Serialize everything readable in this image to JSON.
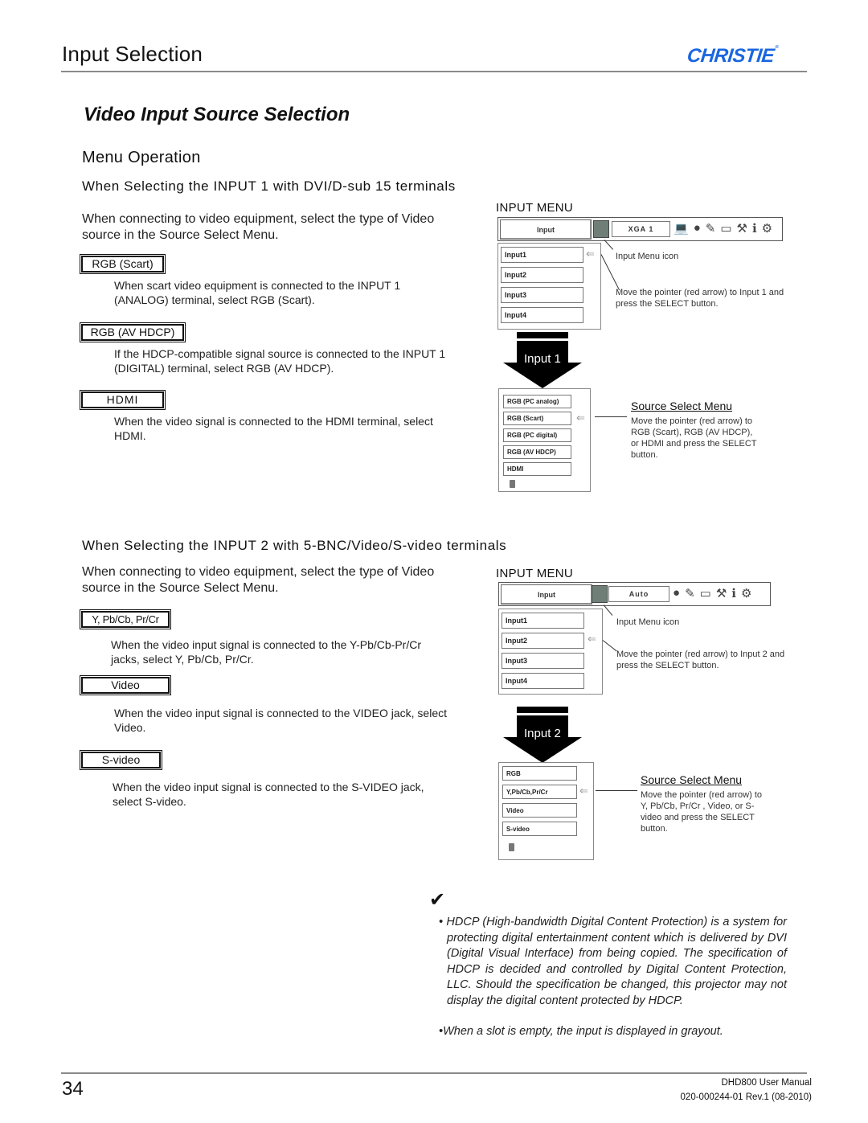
{
  "header": {
    "title": "Input Selection",
    "logo": "CHRISTIE",
    "logo_mark": "®",
    "brand_color": "#1a66e0"
  },
  "section_title": "Video Input Source Selection",
  "subsection_title": "Menu Operation",
  "input1": {
    "heading": "When Selecting the INPUT 1 with DVI/D-sub 15 terminals",
    "intro": "When connecting to video equipment, select the type of Video source in the Source Select Menu.",
    "options": [
      {
        "label": "RGB (Scart)",
        "desc": "When scart video equipment is connected to the INPUT 1 (ANALOG) terminal, select RGB (Scart)."
      },
      {
        "label": "RGB (AV HDCP)",
        "desc": "If the HDCP-compatible signal source is connected to the INPUT 1 (DIGITAL) terminal, select RGB (AV HDCP)."
      },
      {
        "label": "HDMI",
        "desc": "When the video signal is connected to the HDMI terminal, select HDMI."
      }
    ],
    "menu": {
      "label": "INPUT MENU",
      "bar_input": "Input",
      "bar_field": "XGA 1",
      "items": [
        "Input1",
        "Input2",
        "Input3",
        "Input4"
      ],
      "callout_icon": "Input Menu icon",
      "callout_pointer": "Move the pointer (red arrow) to Input 1 and press the SELECT button.",
      "arrow_label": "Input 1",
      "source_menu_title": "Source Select Menu",
      "source_items": [
        "RGB (PC analog)",
        "RGB (Scart)",
        "RGB (PC digital)",
        "RGB (AV HDCP)",
        "HDMI"
      ],
      "source_callout": "Move the pointer (red arrow) to RGB (Scart), RGB (AV HDCP), or HDMI and press the SELECT button."
    }
  },
  "input2": {
    "heading": "When Selecting the INPUT 2 with 5-BNC/Video/S-video terminals",
    "intro": "When connecting to video equipment, select the type of Video source in the Source Select Menu.",
    "options": [
      {
        "label": "Y, Pb/Cb, Pr/Cr",
        "desc": "When the video input signal is connected to the Y-Pb/Cb-Pr/Cr jacks, select Y, Pb/Cb, Pr/Cr."
      },
      {
        "label": "Video",
        "desc": "When the video input signal is connected to the VIDEO jack, select Video."
      },
      {
        "label": "S-video",
        "desc": "When the video input signal is connected to the S-VIDEO jack, select S-video."
      }
    ],
    "menu": {
      "label": "INPUT MENU",
      "bar_input": "Input",
      "bar_field": "Auto",
      "items": [
        "Input1",
        "Input2",
        "Input3",
        "Input4"
      ],
      "callout_icon": "Input Menu icon",
      "callout_pointer": "Move the pointer (red arrow) to Input 2 and press the SELECT button.",
      "arrow_label": "Input 2",
      "source_menu_title": "Source Select Menu",
      "source_items": [
        "RGB",
        "Y,Pb/Cb,Pr/Cr",
        "Video",
        "S-video"
      ],
      "source_callout": "Move the pointer (red arrow) to Y, Pb/Cb, Pr/Cr , Video, or S-video and press the SELECT button."
    }
  },
  "notes": {
    "check_icon": "✔",
    "items": [
      "• HDCP (High-bandwidth Digital Content Protection) is a system for protecting digital entertainment content which is delivered by DVI (Digital Visual Interface) from being copied. The specification of HDCP is decided and controlled by Digital Content Protection, LLC. Should the specification be changed, this projector may not display the digital content protected by HDCP.",
      "•When a slot is empty, the input is displayed in grayout."
    ]
  },
  "footer": {
    "page_number": "34",
    "manual": "DHD800 User Manual",
    "doc_id": "020-000244-01 Rev.1 (08-2010)"
  }
}
